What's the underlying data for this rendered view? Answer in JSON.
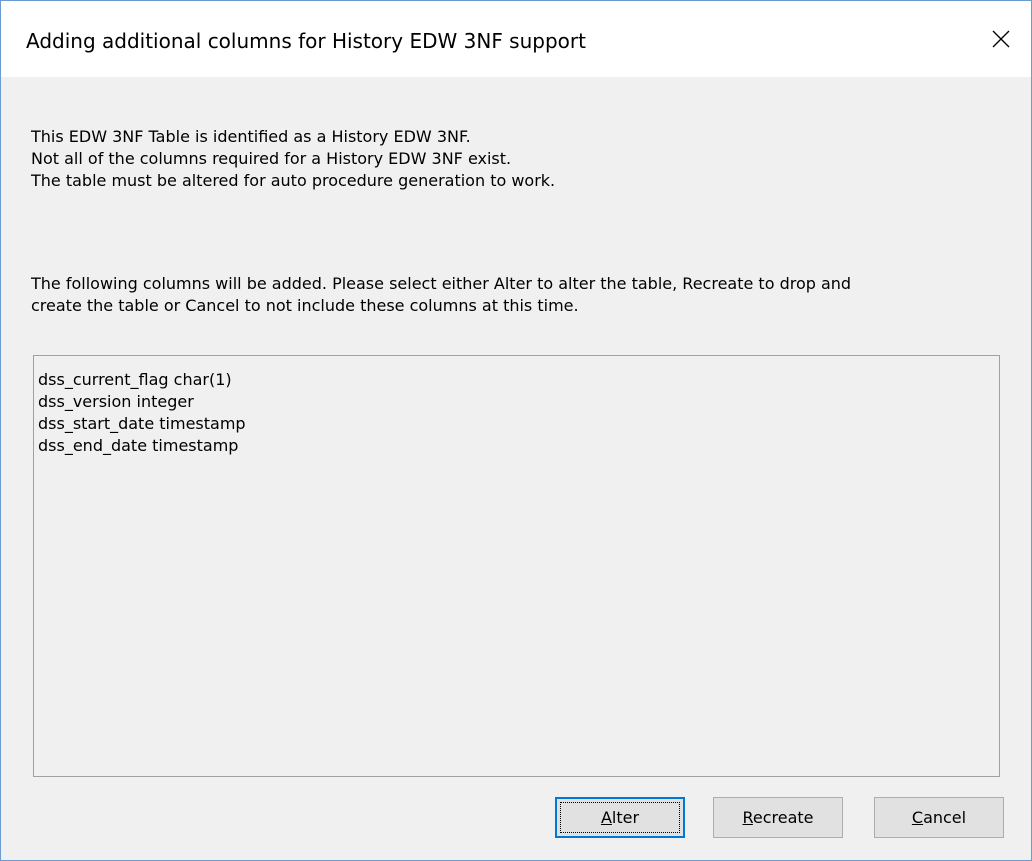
{
  "dialog": {
    "title": "Adding additional columns for History EDW 3NF support",
    "close_icon": "close-icon"
  },
  "message": {
    "intro_lines": [
      "This EDW 3NF Table is identified as a History EDW 3NF.",
      "Not all of the columns required for a History EDW 3NF exist.",
      "The table must be altered for auto procedure generation to work."
    ],
    "instruction_lines": [
      "The following columns will be added. Please select either Alter to alter the table, Recreate to drop and",
      "create the table or Cancel to not include these columns at this time."
    ]
  },
  "columns_list": [
    "dss_current_flag char(1)",
    "dss_version integer",
    "dss_start_date timestamp",
    "dss_end_date timestamp"
  ],
  "buttons": {
    "alter": {
      "mnemonic": "A",
      "rest": "lter"
    },
    "recreate": {
      "mnemonic": "R",
      "rest": "ecreate"
    },
    "cancel": {
      "mnemonic": "C",
      "rest": "ancel"
    }
  },
  "colors": {
    "focus_border": "#0078d7",
    "window_border": "#6b9bd1",
    "dialog_background": "#f0f0f0"
  }
}
